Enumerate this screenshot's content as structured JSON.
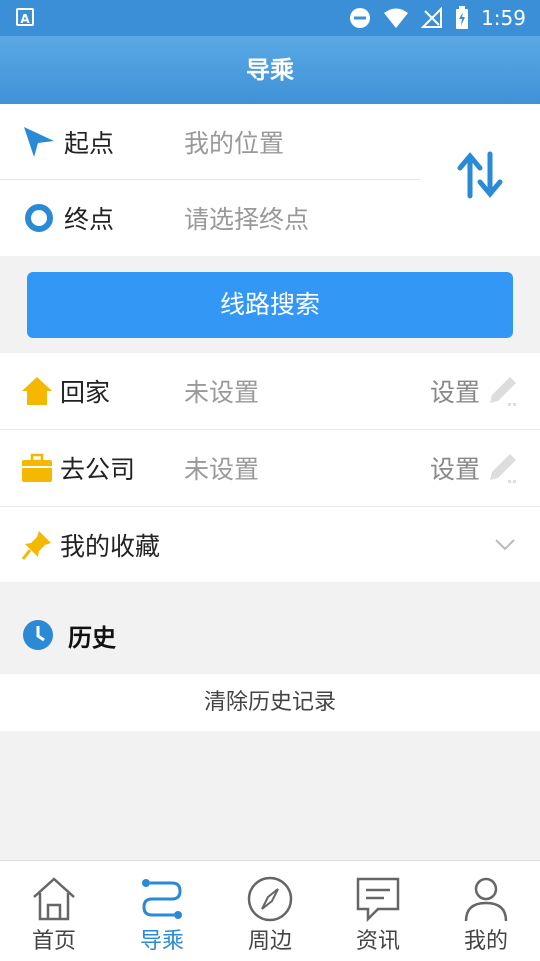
{
  "status_bar": {
    "time": "1:59"
  },
  "header": {
    "title": "导乘"
  },
  "route": {
    "start_label": "起点",
    "start_value": "我的位置",
    "end_label": "终点",
    "end_placeholder": "请选择终点"
  },
  "search_button": "线路搜索",
  "quick": [
    {
      "label": "回家",
      "value": "未设置",
      "action": "设置"
    },
    {
      "label": "去公司",
      "value": "未设置",
      "action": "设置"
    },
    {
      "label": "我的收藏"
    }
  ],
  "history": {
    "title": "历史",
    "clear": "清除历史记录"
  },
  "tabs": [
    {
      "label": "首页"
    },
    {
      "label": "导乘"
    },
    {
      "label": "周边"
    },
    {
      "label": "资讯"
    },
    {
      "label": "我的"
    }
  ],
  "colors": {
    "primary": "#3398f5",
    "header": "#4a9be0",
    "tab_active": "#2a8ad6",
    "home_icon": "#f5b800"
  }
}
